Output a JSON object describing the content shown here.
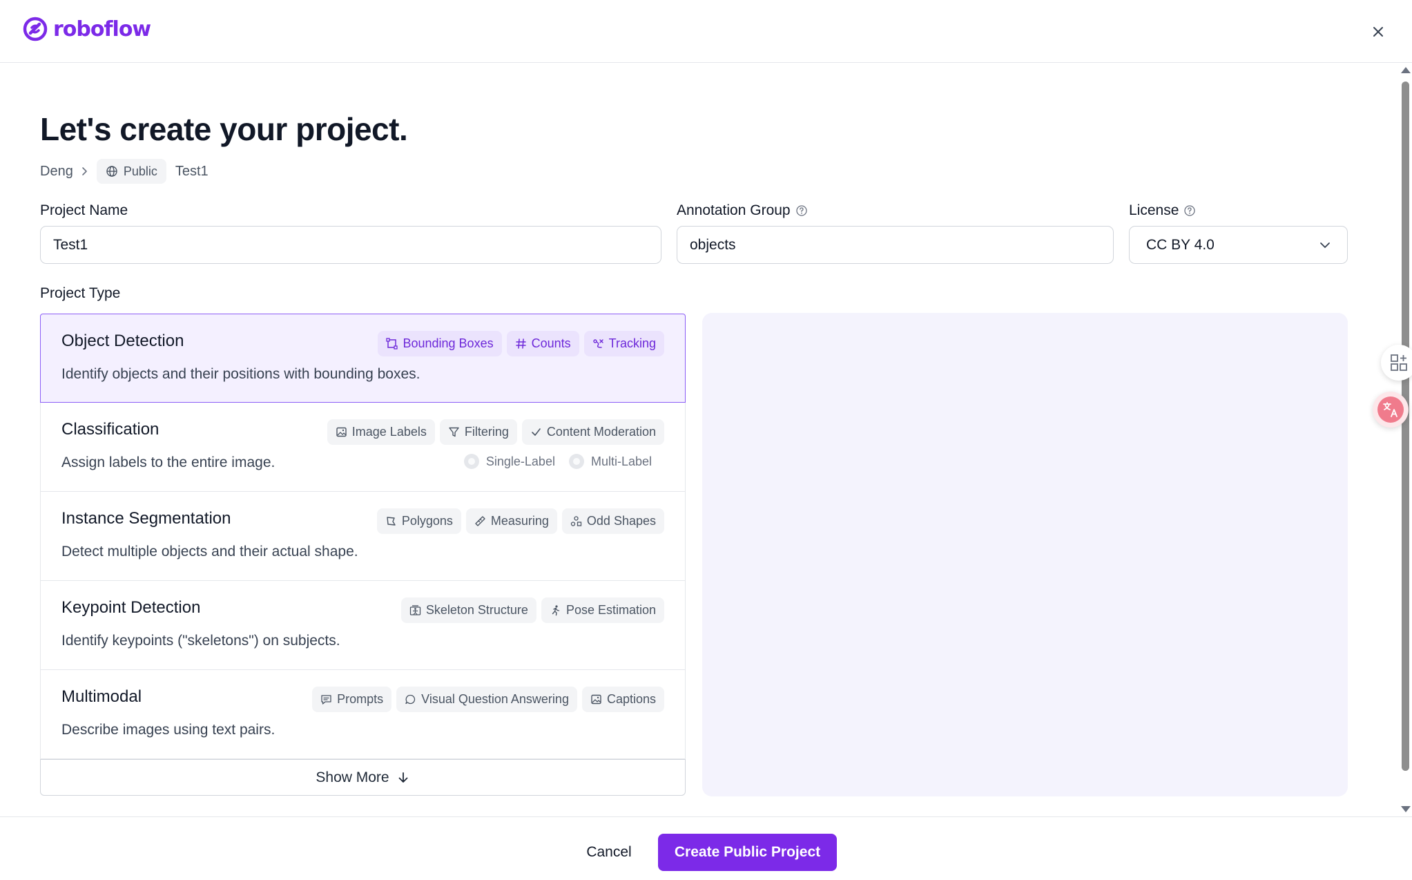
{
  "brand": {
    "name": "roboflow",
    "color": "#7c2ae8"
  },
  "page": {
    "title": "Let's create your project."
  },
  "breadcrumb": {
    "workspace": "Deng",
    "visibility": "Public",
    "project": "Test1"
  },
  "form": {
    "project_name": {
      "label": "Project Name",
      "value": "Test1"
    },
    "annotation_group": {
      "label": "Annotation Group",
      "value": "objects"
    },
    "license": {
      "label": "License",
      "value": "CC BY 4.0"
    },
    "project_type_label": "Project Type"
  },
  "project_types": [
    {
      "name": "Object Detection",
      "description": "Identify objects and their positions with bounding boxes.",
      "selected": true,
      "tags": [
        {
          "icon": "bounding-box-icon",
          "label": "Bounding Boxes"
        },
        {
          "icon": "hash-icon",
          "label": "Counts"
        },
        {
          "icon": "tracking-icon",
          "label": "Tracking"
        }
      ]
    },
    {
      "name": "Classification",
      "description": "Assign labels to the entire image.",
      "selected": false,
      "tags": [
        {
          "icon": "image-icon",
          "label": "Image Labels"
        },
        {
          "icon": "filter-icon",
          "label": "Filtering"
        },
        {
          "icon": "check-icon",
          "label": "Content Moderation"
        }
      ],
      "options": [
        "Single-Label",
        "Multi-Label"
      ]
    },
    {
      "name": "Instance Segmentation",
      "description": "Detect multiple objects and their actual shape.",
      "selected": false,
      "tags": [
        {
          "icon": "polygon-icon",
          "label": "Polygons"
        },
        {
          "icon": "ruler-icon",
          "label": "Measuring"
        },
        {
          "icon": "shapes-icon",
          "label": "Odd Shapes"
        }
      ]
    },
    {
      "name": "Keypoint Detection",
      "description": "Identify keypoints (\"skeletons\") on subjects.",
      "selected": false,
      "tags": [
        {
          "icon": "skeleton-icon",
          "label": "Skeleton Structure"
        },
        {
          "icon": "running-person-icon",
          "label": "Pose Estimation"
        }
      ]
    },
    {
      "name": "Multimodal",
      "description": "Describe images using text pairs.",
      "selected": false,
      "tags": [
        {
          "icon": "message-square-icon",
          "label": "Prompts"
        },
        {
          "icon": "message-circle-icon",
          "label": "Visual Question Answering"
        },
        {
          "icon": "image-icon",
          "label": "Captions"
        }
      ]
    }
  ],
  "show_more": "Show More",
  "footer": {
    "cancel": "Cancel",
    "create": "Create Public Project"
  }
}
